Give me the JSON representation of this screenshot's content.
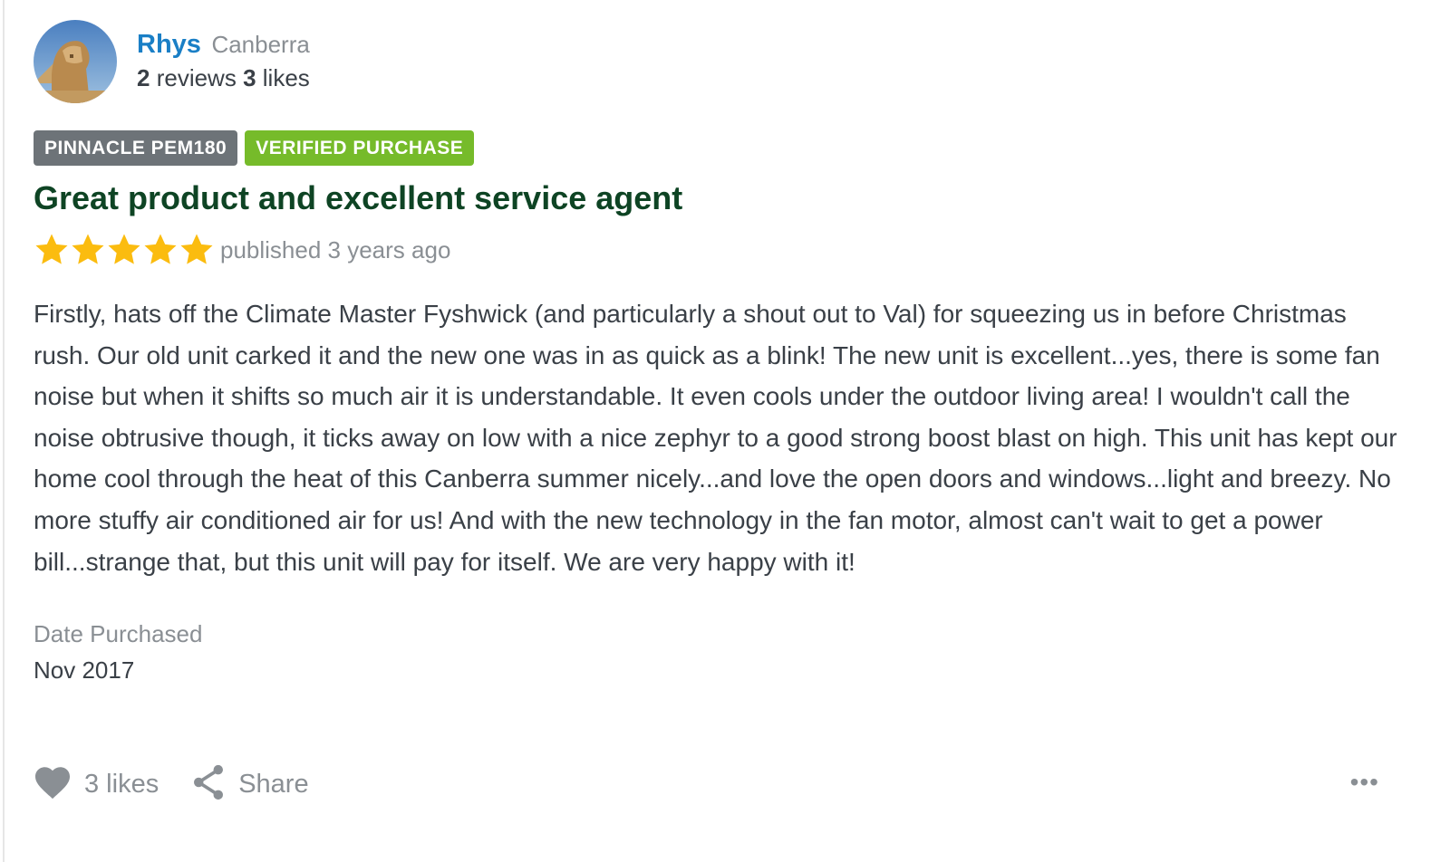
{
  "reviewer": {
    "name": "Rhys",
    "location": "Canberra",
    "review_count": "2",
    "reviews_label": "reviews",
    "like_count": "3",
    "likes_label": "likes"
  },
  "badges": {
    "model": "PINNACLE PEM180",
    "verified": "VERIFIED PURCHASE"
  },
  "review": {
    "title": "Great product and excellent service agent",
    "rating": 5,
    "rating_max": 5,
    "published": "published 3 years ago",
    "body": "Firstly, hats off the Climate Master Fyshwick (and particularly a shout out to Val) for squeezing us in before Christmas rush. Our old unit carked it and the new one was in as quick as a blink! The new unit is excellent...yes, there is some fan noise but when it shifts so much air it is understandable. It even cools under the outdoor living area! I wouldn't call the noise obtrusive though, it ticks away on low with a nice zephyr to a good strong boost blast on high. This unit has kept our home cool through the heat of this Canberra summer nicely...and love the open doors and windows...light and breezy. No more stuffy air conditioned air for us! And with the new technology in the fan motor, almost can't wait to get a power bill...strange that, but this unit will pay for itself. We are very happy with it!"
  },
  "meta": {
    "date_purchased_label": "Date Purchased",
    "date_purchased_value": "Nov 2017"
  },
  "actions": {
    "likes_label": "3 likes",
    "share_label": "Share",
    "more_label": "•••"
  },
  "icons": {
    "like": "heart-icon",
    "share": "share-icon",
    "more": "ellipsis-icon",
    "star": "star-icon"
  },
  "colors": {
    "name_link": "#1a7fc6",
    "title": "#0e4424",
    "badge_model": "#6d7378",
    "badge_verified": "#76bb2a",
    "star": "#fbbc0f",
    "muted": "#8a8f94"
  }
}
